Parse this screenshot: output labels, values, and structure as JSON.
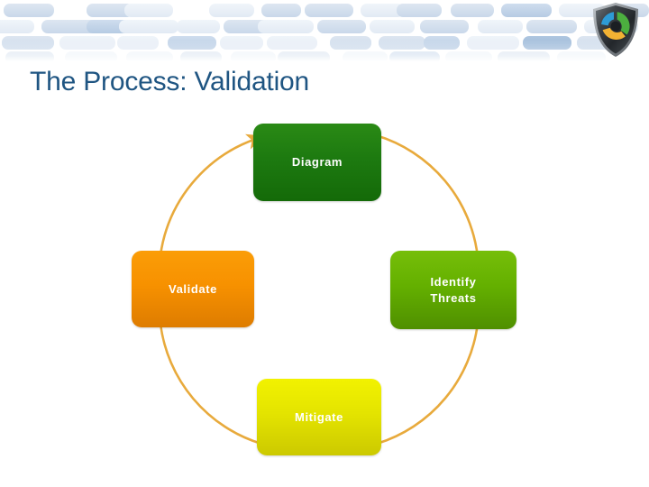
{
  "slide": {
    "title": "The Process: Validation",
    "title_color": "#1f5582",
    "background_color": "#ffffff"
  },
  "header": {
    "logo": {
      "icon": "shield-recycle-logo",
      "shield_color": "#3a3f44",
      "segment_colors": [
        "#2e9bd6",
        "#4caf3f",
        "#f2b233"
      ]
    },
    "pattern": {
      "icon": "brick-pattern",
      "brick_colors": [
        "#e8eef6",
        "#dbe5f0",
        "#ccdaea",
        "#b9cee4",
        "#f2f6fa"
      ]
    }
  },
  "diagram": {
    "type": "cycle",
    "arc_color": "#e8aa3c",
    "direction": "clockwise",
    "arrow_target": "Diagram",
    "nodes": [
      {
        "id": "diagram",
        "label": "Diagram",
        "position": "top",
        "color": "#1d7a10"
      },
      {
        "id": "identify-threats",
        "label": "Identify\nThreats",
        "line1": "Identify",
        "line2": "Threats",
        "position": "right",
        "color": "#64b000"
      },
      {
        "id": "mitigate",
        "label": "Mitigate",
        "position": "bottom",
        "color": "#e4e400"
      },
      {
        "id": "validate",
        "label": "Validate",
        "position": "left",
        "color": "#f79100"
      }
    ]
  }
}
